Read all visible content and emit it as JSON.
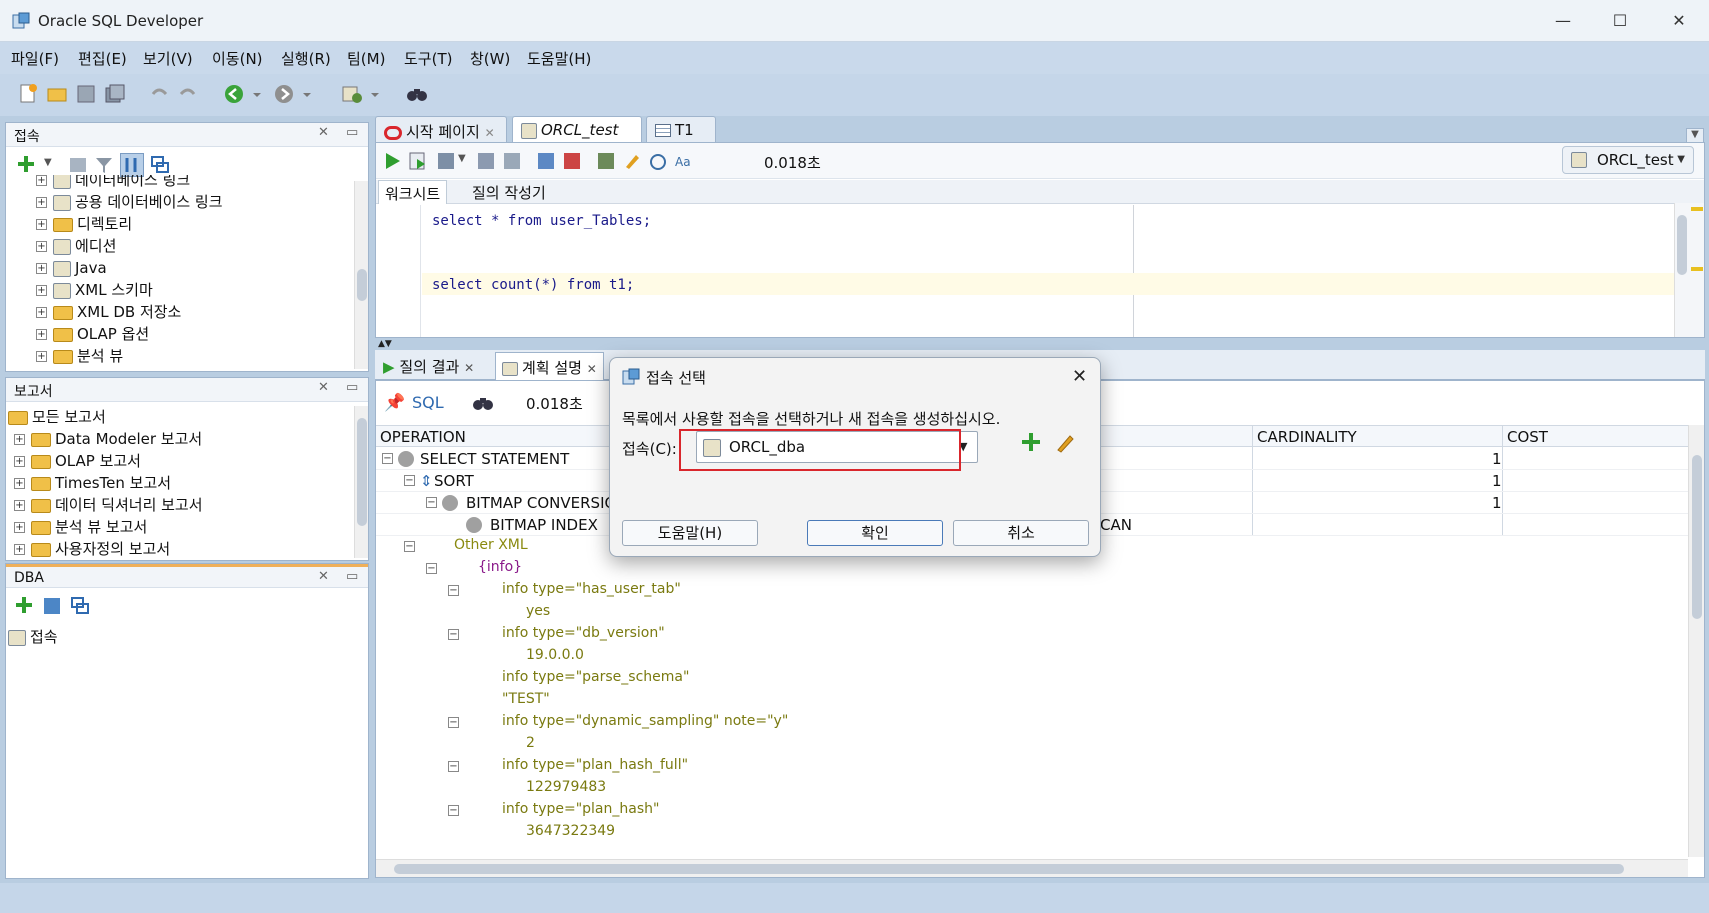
{
  "window": {
    "title": "Oracle SQL Developer",
    "min": "—",
    "max": "☐",
    "close": "✕"
  },
  "menu": [
    "파일(F)",
    "편집(E)",
    "보기(V)",
    "이동(N)",
    "실행(R)",
    "팀(M)",
    "도구(T)",
    "창(W)",
    "도움말(H)"
  ],
  "connections_panel": {
    "title": "접속",
    "items": [
      "데이터베이스 링크",
      "공용 데이터베이스 링크",
      "디렉토리",
      "에디션",
      "Java",
      "XML 스키마",
      "XML DB 저장소",
      "OLAP 옵션",
      "분석 뷰"
    ]
  },
  "reports_panel": {
    "title": "보고서",
    "root": "모든 보고서",
    "items": [
      "Data Modeler 보고서",
      "OLAP 보고서",
      "TimesTen 보고서",
      "데이터 딕셔너리 보고서",
      "분석 뷰 보고서",
      "사용자정의 보고서"
    ]
  },
  "dba_panel": {
    "title": "DBA",
    "item": "접속"
  },
  "editor_tabs": [
    {
      "label": "시작 페이지"
    },
    {
      "label": "ORCL_test"
    },
    {
      "label": "T1"
    }
  ],
  "editor_toolbar": {
    "elapsed": "0.018초",
    "connection": "ORCL_test"
  },
  "editor_subtabs": [
    "워크시트",
    "질의 작성기"
  ],
  "sql": {
    "line1": "select * from user_Tables;",
    "line2": "select count(*) from t1;"
  },
  "result_tabs": [
    "질의 결과",
    "계획 설명"
  ],
  "result_toolbar": {
    "sql": "SQL",
    "elapsed": "0.018초"
  },
  "plan_columns": {
    "operation": "OPERATION",
    "cardinality": "CARDINALITY",
    "cost": "COST"
  },
  "plan_rows": [
    {
      "op": "SELECT STATEMENT",
      "cardinality": "1"
    },
    {
      "op": "SORT",
      "cardinality": "1"
    },
    {
      "op": "BITMAP CONVERSION",
      "cardinality": "1"
    },
    {
      "op": "BITMAP INDEX",
      "tail": "CAN"
    }
  ],
  "other_xml": {
    "label": "Other XML",
    "info": "{info}",
    "entries": [
      "info type=\"has_user_tab\"",
      "yes",
      "info type=\"db_version\"",
      "19.0.0.0",
      "info type=\"parse_schema\"",
      "\"TEST\"",
      "info type=\"dynamic_sampling\" note=\"y\"",
      "2",
      "info type=\"plan_hash_full\"",
      "122979483",
      "info type=\"plan_hash\"",
      "3647322349"
    ]
  },
  "dialog": {
    "title": "접속 선택",
    "message": "목록에서 사용할 접속을 선택하거나 새 접속을 생성하십시오.",
    "field_label": "접속(C):",
    "selected": "ORCL_dba",
    "help": "도움말(H)",
    "ok": "확인",
    "cancel": "취소"
  },
  "colors": {
    "accent": "#d9262c",
    "titlebar": "#eef3f8",
    "chrome": "#c5d6e9"
  }
}
